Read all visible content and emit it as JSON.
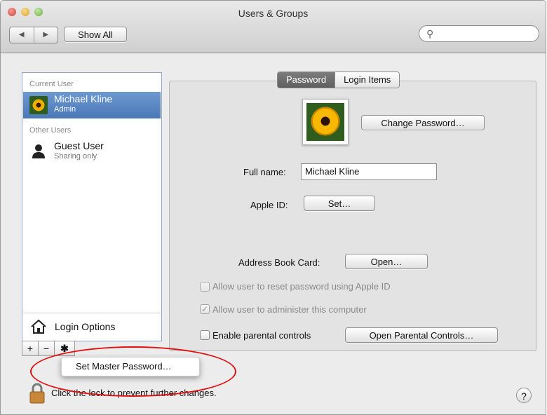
{
  "window": {
    "title": "Users & Groups",
    "show_all_label": "Show All",
    "search": {
      "placeholder": "",
      "value": ""
    }
  },
  "sidebar": {
    "current_user_heading": "Current User",
    "current_user": {
      "name": "Michael Kline",
      "role": "Admin"
    },
    "other_users_heading": "Other Users",
    "other_users": [
      {
        "name": "Guest User",
        "role": "Sharing only"
      }
    ],
    "login_options_label": "Login Options",
    "add_label": "+",
    "remove_label": "−",
    "gear_label": "✱"
  },
  "context_menu": {
    "items": [
      {
        "label": "Set Master Password…"
      }
    ]
  },
  "tabs": [
    {
      "label": "Password",
      "active": true
    },
    {
      "label": "Login Items",
      "active": false
    }
  ],
  "password_panel": {
    "change_password_label": "Change Password…",
    "full_name_label": "Full name:",
    "full_name_value": "Michael Kline",
    "apple_id_label": "Apple ID:",
    "apple_id_button": "Set…",
    "address_book_label": "Address Book Card:",
    "address_book_button": "Open…",
    "checkboxes": [
      {
        "label": "Allow user to reset password using Apple ID",
        "checked": false,
        "enabled": false
      },
      {
        "label": "Allow user to administer this computer",
        "checked": true,
        "enabled": false
      },
      {
        "label": "Enable parental controls",
        "checked": false,
        "enabled": true
      }
    ],
    "open_parental_controls_label": "Open Parental Controls…"
  },
  "footer": {
    "lock_text": "Click the lock to prevent further changes.",
    "help_label": "?"
  },
  "colors": {
    "selection": "#4a78b8",
    "annotation_ellipse": "#e01010",
    "close_button": "#e0504a",
    "minimize_button": "#e3b540",
    "zoom_button": "#7cbc4c"
  },
  "icons": [
    "back-icon",
    "forward-icon",
    "search-icon",
    "house-icon",
    "gear-icon",
    "lock-icon",
    "help-icon"
  ]
}
